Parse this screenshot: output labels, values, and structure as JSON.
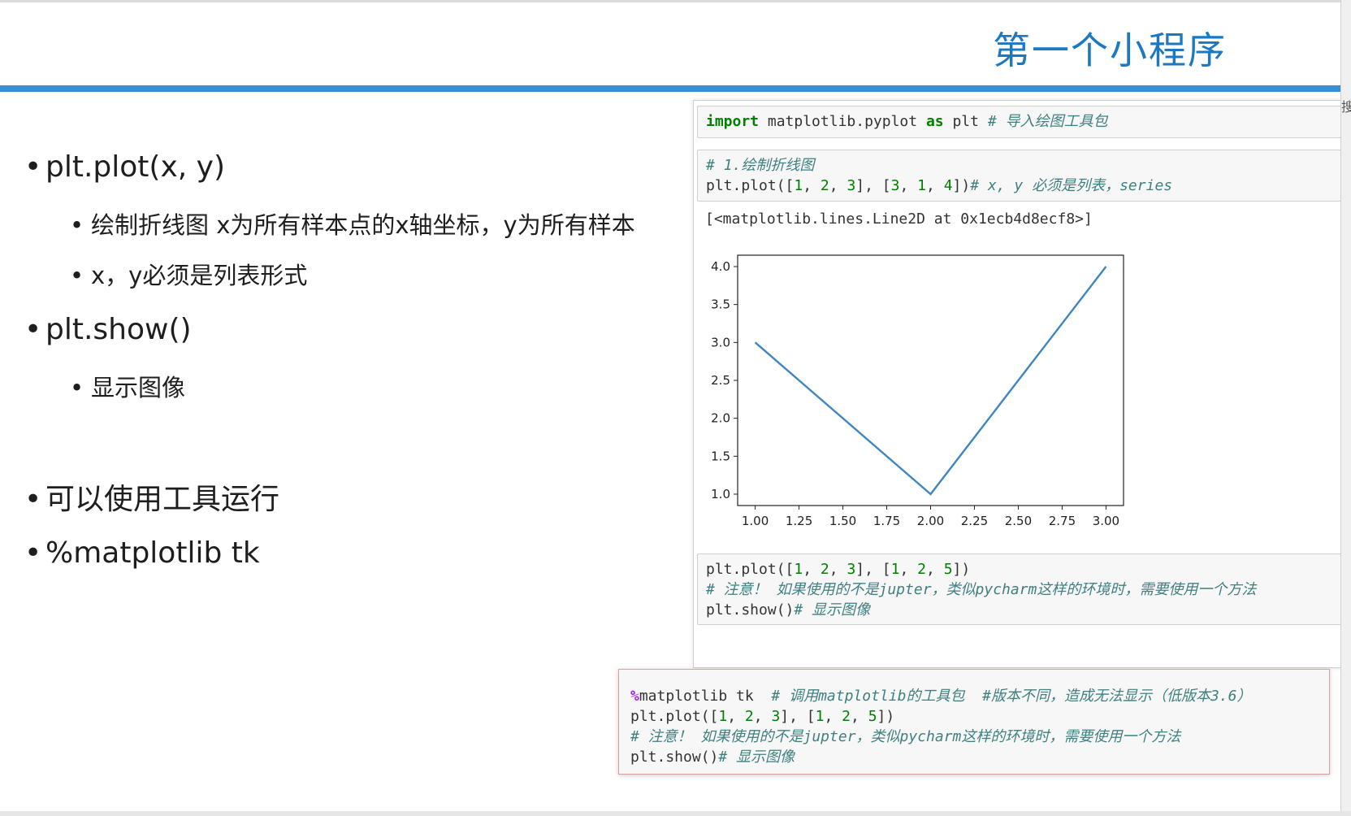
{
  "slide": {
    "title": "第一个小程序",
    "bullets": [
      {
        "level": 1,
        "text": "plt.plot(x, y)"
      },
      {
        "level": 2,
        "text": "绘制折线图   x为所有样本点的x轴坐标，y为所有样本"
      },
      {
        "level": 2,
        "text": "x，y必须是列表形式"
      },
      {
        "level": 1,
        "text": "plt.show()"
      },
      {
        "level": 2,
        "text": "显示图像"
      },
      {
        "level": 1,
        "text": "可以使用工具运行"
      },
      {
        "level": 1,
        "text": "%matplotlib tk"
      }
    ],
    "bullet_glyph": "•",
    "right_edge_fragment": "搜索"
  },
  "notebook": {
    "cell1": {
      "kw_import": "import",
      "mod": " matplotlib.pyplot ",
      "kw_as": "as",
      "alias": " plt ",
      "comment": "# 导入绘图工具包"
    },
    "cell2": {
      "comment1": "# 1.绘制折线图",
      "code_a": "plt.plot([",
      "n1": "1",
      "n2": "2",
      "n3": "3",
      "code_b": "], [",
      "m1": "3",
      "m2": "1",
      "m3": "4",
      "code_c": "])",
      "comment2": "# x, y 必须是列表，series",
      "sep": ", "
    },
    "output_text": "[<matplotlib.lines.Line2D at 0x1ecb4d8ecf8>]",
    "cell3": {
      "code_a": "plt.plot([",
      "n1": "1",
      "n2": "2",
      "n3": "3",
      "code_b": "], [",
      "m1": "1",
      "m2": "2",
      "m3": "5",
      "code_c": "])",
      "comment": "# 注意！ 如果使用的不是jupter，类似pycharm这样的环境时，需要使用一个方法",
      "show": "plt.show()",
      "show_comment": "# 显示图像",
      "sep": ", "
    },
    "cell4": {
      "magic_pct": "%",
      "magic_rest": "matplotlib tk  ",
      "magic_comment": "# 调用matplotlib的工具包  #版本不同，造成无法显示（低版本3.6）",
      "code_a": "plt.plot([",
      "n1": "1",
      "n2": "2",
      "n3": "3",
      "code_b": "], [",
      "m1": "1",
      "m2": "2",
      "m3": "5",
      "code_c": "])",
      "comment": "# 注意！ 如果使用的不是jupter，类似pycharm这样的环境时，需要使用一个方法",
      "show": "plt.show()",
      "show_comment": "# 显示图像",
      "sep": ", "
    }
  },
  "colors": {
    "title": "#1b78c2",
    "rule": "#3a8fd3",
    "line": "#3f86c0",
    "keyword": "#008000",
    "comment": "#408080",
    "magic": "#aa22ff"
  },
  "chart_data": {
    "type": "line",
    "x": [
      1,
      2,
      3
    ],
    "y": [
      3,
      1,
      4
    ],
    "xlim": [
      0.9,
      3.1
    ],
    "ylim": [
      0.85,
      4.15
    ],
    "xticks": [
      "1.00",
      "1.25",
      "1.50",
      "1.75",
      "2.00",
      "2.25",
      "2.50",
      "2.75",
      "3.00"
    ],
    "yticks": [
      "1.0",
      "1.5",
      "2.0",
      "2.5",
      "3.0",
      "3.5",
      "4.0"
    ],
    "grid": false,
    "title": "",
    "xlabel": "",
    "ylabel": ""
  }
}
